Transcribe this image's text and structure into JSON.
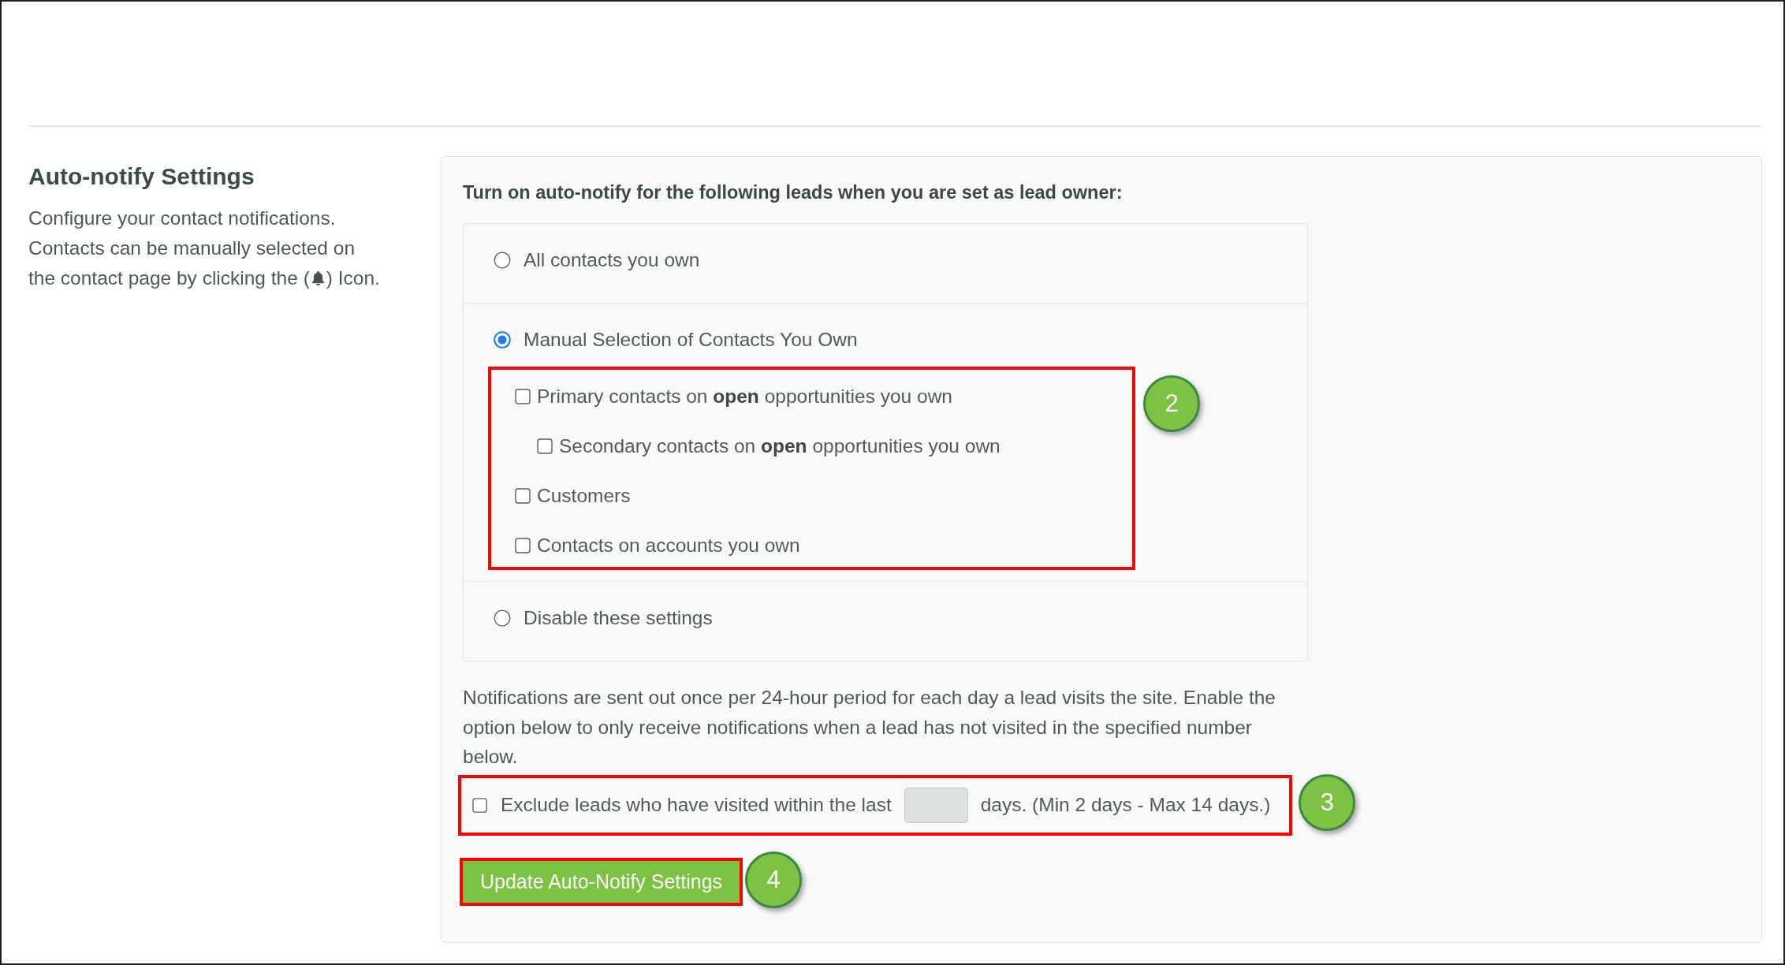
{
  "section": {
    "title": "Auto-notify Settings",
    "description": "Configure your contact notifications.\nContacts can be manually selected on",
    "description_end_before_icon": "the contact page by clicking the (",
    "description_end_after_icon": ") Icon."
  },
  "panel": {
    "prompt": "Turn on auto-notify for the following leads when you are set as lead owner:",
    "options": [
      {
        "label": "All contacts you own",
        "selected": false
      },
      {
        "label": "Manual Selection of Contacts You Own",
        "selected": true,
        "annotation": "2",
        "suboptions": [
          {
            "label": "Primary contacts on **open** opportunities you own",
            "checked": false,
            "children": [
              {
                "label": "Secondary contacts on **open** opportunities you own",
                "checked": false
              }
            ]
          },
          {
            "label": "Customers",
            "checked": false
          },
          {
            "label": "Contacts on accounts you own",
            "checked": false
          }
        ]
      },
      {
        "label": "Disable these settings",
        "selected": false
      }
    ],
    "note": "Notifications are sent out once per 24-hour period for each day a lead visits the site. Enable the\noption below to only receive notifications when a lead has not visited in the specified number\nbelow.",
    "exclusion": {
      "checked": false,
      "label_before": "Exclude leads who have visited within the last",
      "label_after": "days. (Min 2 days - Max 14 days.)",
      "annotation": "3"
    },
    "submit": {
      "label": "Update Auto-Notify Settings",
      "annotation": "4"
    }
  }
}
